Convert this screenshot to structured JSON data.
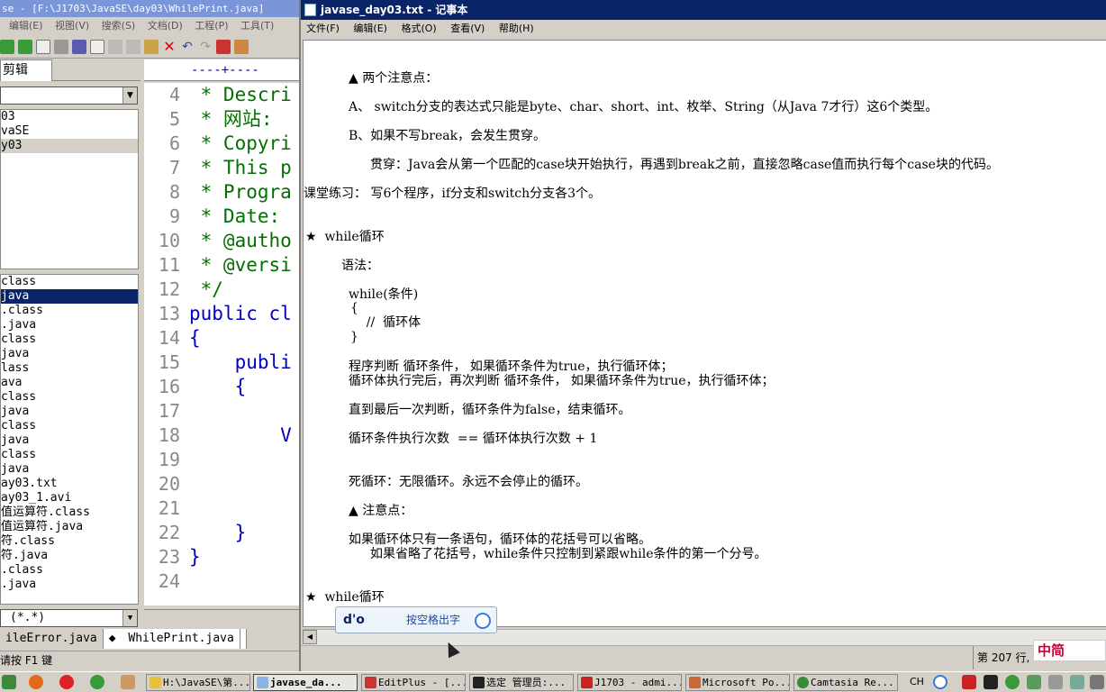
{
  "editplus": {
    "title": "se - [F:\\J1703\\JavaSE\\day03\\WhilePrint.java]",
    "menu": [
      "编辑(E)",
      "视图(V)",
      "搜索(S)",
      "文档(D)",
      "工程(P)",
      "工具(T)"
    ],
    "clip_tab": "剪辑",
    "dirs": [
      "03",
      "vaSE",
      "y03"
    ],
    "files": [
      "class",
      "java",
      ".class",
      ".java",
      "class",
      "java",
      "lass",
      "ava",
      "class",
      "java",
      "class",
      "java",
      "class",
      "java",
      "ay03.txt",
      "ay03_1.avi",
      "值运算符.class",
      "值运算符.java",
      "符.class",
      "符.java",
      ".class",
      ".java"
    ],
    "selected_file_index": 1,
    "filter": "(*.*)",
    "ruler": "----+----",
    "line_numbers": [
      "4",
      "5",
      "6",
      "7",
      "8",
      "9",
      "10",
      "11",
      "12",
      "13",
      "14",
      "15",
      "16",
      "17",
      "18",
      "19",
      "20",
      "21",
      "22",
      "23",
      "24"
    ],
    "code_lines": [
      " * Descri",
      " * 网站:",
      " * Copyri",
      " * This p",
      " * Progra",
      " * Date:",
      " * @autho",
      " * @versi",
      " */",
      "public cl",
      "{",
      "    publi",
      "    {",
      "        ",
      "        V",
      "",
      "",
      "",
      "    }",
      "}",
      ""
    ],
    "doc_tabs": [
      "ileError.java",
      "WhilePrint.java"
    ],
    "status": "请按 F1 键"
  },
  "notepad": {
    "title": "javase_day03.txt - 记事本",
    "menu": [
      "文件(F)",
      "编辑(E)",
      "格式(O)",
      "查看(V)",
      "帮助(H)"
    ],
    "lines": [
      "▲ 两个注意点：",
      "A、 switch分支的表达式只能是byte、char、short、int、枚举、String（从Java 7才行）这6个类型。",
      "B、如果不写break，会发生贯穿。",
      "贯穿：Java会从第一个匹配的case块开始执行，再遇到break之前，直接忽略case值而执行每个case块的代码。",
      "课堂练习： 写6个程序，if分支和switch分支各3个。",
      "★  while循环",
      "语法：",
      "while(条件)",
      "{",
      "    //  循环体",
      "}",
      "程序判断 循环条件， 如果循环条件为true，执行循环体；",
      "循环体执行完后，再次判断 循环条件， 如果循环条件为true，执行循环体；",
      "直到最后一次判断，循环条件为false，结束循环。",
      "循环条件执行次数  == 循环体执行次数 + 1",
      "死循环：无限循环。永远不会停止的循环。",
      "▲ 注意点：",
      "如果循环体只有一条语句，循环体的花括号可以省略。",
      "如果省略了花括号，while条件只控制到紧跟while条件的第一个分号。",
      "★  while循环"
    ],
    "status_pos": "第 207 行,"
  },
  "ime": {
    "input": "d'o",
    "hint": "按空格出字",
    "bar": "中简"
  },
  "taskbar": {
    "tasks": [
      "H:\\JavaSE\\第...",
      "javase_da...",
      "EditPlus - [...",
      "选定 管理员:...",
      "J1703 - admi...",
      "Microsoft Po...",
      "Camtasia Re..."
    ],
    "active_index": 1,
    "lang": "CH"
  }
}
